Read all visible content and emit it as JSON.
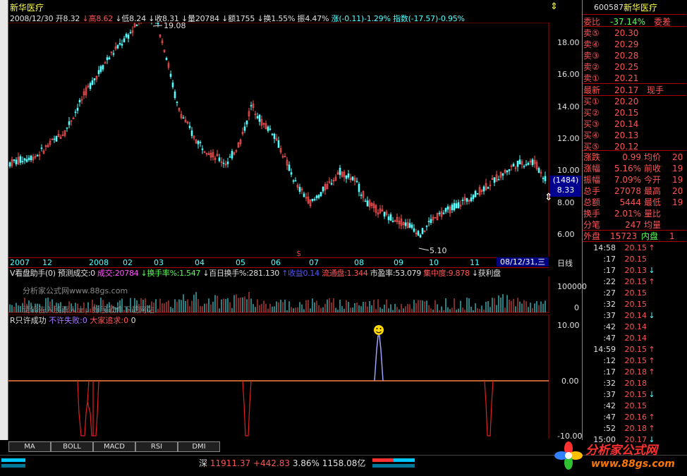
{
  "stock": {
    "name": "新华医疗",
    "code": "600587"
  },
  "ohlc": {
    "date": "2008/12/30",
    "open_lbl": "开",
    "open": "8.32",
    "high_lbl": "↓高",
    "high": "8.62",
    "low_lbl": "↓低",
    "low": "8.24",
    "close_lbl": "↓收",
    "close": "8.31",
    "vol_lbl": "↓量",
    "vol": "20784",
    "amt_lbl": "↓额",
    "amt": "1755",
    "turn": "↓换1.55%",
    "amp": "振4.47%",
    "chg": "涨(-0.11)-1.29%",
    "idx": "指数(-17.57)-0.95%"
  },
  "price_axis": [
    "18.00",
    "16.00",
    "14.00",
    "12.00",
    "10.00",
    "8.00",
    "6.00"
  ],
  "price_hl": {
    "a": "(1484)",
    "b": "8.33"
  },
  "markers": {
    "high": "19.08",
    "low": "5.10",
    "s": "$"
  },
  "dates": [
    "2007",
    "12",
    "2008",
    "02",
    "03",
    "04",
    "05",
    "06",
    "07",
    "08",
    "09",
    "10",
    "11"
  ],
  "date_sel": "08/12/31,三",
  "period": "日线",
  "vol_head": {
    "a": "V看盘助手(0)",
    "b": "预测成交:0",
    "c": "成交:",
    "d": "20784",
    "e": "↓换手率%",
    "f": ":1.547",
    "g": "↓百日换手%:281.130",
    "h": "↑收益",
    "i": "0.14",
    "j": "流通盘:1.344",
    "k": "市盈率:53.079",
    "l": "集中度:9.878",
    "m": "↓获利盘"
  },
  "vol_axis": [
    "100000",
    "0"
  ],
  "watermark1": "分析家公式网www.88gs.com",
  "watermark2": "请转告入股票人士，好股软件下载网站",
  "ind_head": {
    "a": "R只许成功",
    "b": "不许失败:0",
    "c": "大家追求:0",
    "d": "0"
  },
  "ind_axis": [
    "10.00",
    "0.00",
    "-10.00"
  ],
  "tabs": [
    "MA",
    "BOLL",
    "MACD",
    "RSI",
    "DMI"
  ],
  "statusbar": {
    "mkt": "深",
    "idx": "11911.37",
    "chg": "+442.83",
    "pct": "3.86%",
    "amt": "1158.08亿"
  },
  "logo": {
    "cn": "分析家公式网",
    "url": "www.88gs.com"
  },
  "panel": {
    "webi": {
      "l": "委比",
      "v": "-37.14%",
      "l2": "委差"
    },
    "sell": [
      [
        "卖⑤",
        "20.30"
      ],
      [
        "卖④",
        "20.29"
      ],
      [
        "卖③",
        "20.28"
      ],
      [
        "卖②",
        "20.25"
      ],
      [
        "卖①",
        "20.21"
      ]
    ],
    "last": {
      "l": "最新",
      "v": "20.17",
      "l2": "现手"
    },
    "buy": [
      [
        "买①",
        "20.20"
      ],
      [
        "买②",
        "20.15"
      ],
      [
        "买③",
        "20.14"
      ],
      [
        "买④",
        "20.13"
      ],
      [
        "买⑤",
        "20.12"
      ]
    ],
    "stats": [
      [
        "涨跌",
        "0.99",
        "均价",
        "20"
      ],
      [
        "涨幅",
        "5.16%",
        "前收",
        "19"
      ],
      [
        "振幅",
        "7.09%",
        "今开",
        "19"
      ],
      [
        "总手",
        "27078",
        "最高",
        "20"
      ],
      [
        "总额",
        "5444",
        "最低",
        "19"
      ],
      [
        "换手",
        "2.01%",
        "量比",
        ""
      ],
      [
        "分笔",
        "247",
        "均量",
        ""
      ]
    ],
    "outer": {
      "l": "外盘",
      "v": "15723",
      "l2": "内盘",
      "v2": "1"
    },
    "ticks": [
      [
        "14:58",
        "20.15",
        "↑"
      ],
      [
        ":17",
        "20.15",
        ""
      ],
      [
        ":17",
        "20.13",
        "↓"
      ],
      [
        ":22",
        "20.15",
        "↑"
      ],
      [
        ":27",
        "20.15",
        ""
      ],
      [
        ":32",
        "20.15",
        ""
      ],
      [
        ":37",
        "20.14",
        "↓"
      ],
      [
        ":42",
        "20.14",
        ""
      ],
      [
        ":47",
        "20.14",
        ""
      ],
      [
        "14:59",
        "20.15",
        "↑"
      ],
      [
        ":12",
        "20.15",
        "↑"
      ],
      [
        ":17",
        "20.18",
        "↑"
      ],
      [
        ":32",
        "20.18",
        ""
      ],
      [
        ":37",
        "20.15",
        "↓"
      ],
      [
        ":42",
        "20.15",
        ""
      ],
      [
        ":47",
        "20.16",
        "↑"
      ],
      [
        ":52",
        "20.18",
        "↑"
      ],
      [
        "15:00",
        "20.17",
        "↓"
      ]
    ]
  }
}
